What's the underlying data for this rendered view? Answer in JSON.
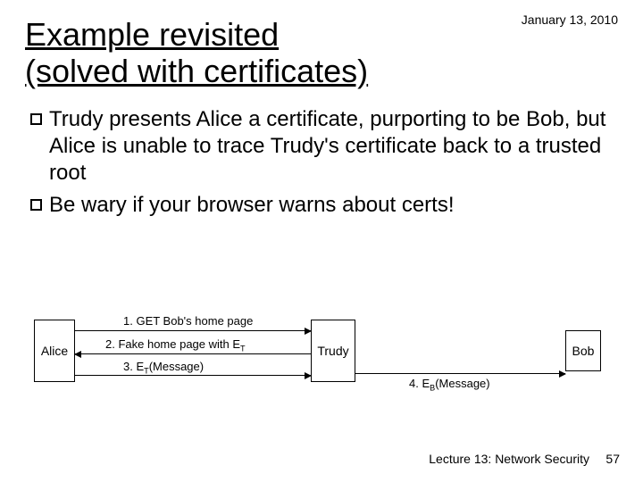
{
  "header": {
    "date": "January 13, 2010",
    "title_line1": "Example revisited",
    "title_line2": "(solved with certificates)"
  },
  "bullets": [
    "Trudy presents Alice a certificate, purporting to be Bob, but Alice is unable to trace Trudy's certificate back to a trusted root",
    "Be wary if your browser warns about certs!"
  ],
  "diagram": {
    "nodes": {
      "alice": "Alice",
      "trudy": "Trudy",
      "bob": "Bob"
    },
    "edges": {
      "e1": "1. GET Bob's home page",
      "e2_prefix": "2. Fake home page with E",
      "e2_sub": "T",
      "e3_prefix": "3. E",
      "e3_sub": "T",
      "e3_suffix": "(Message)",
      "e4_prefix": "4. E",
      "e4_sub": "B",
      "e4_suffix": "(Message)"
    }
  },
  "footer": {
    "lecture": "Lecture 13: Network Security",
    "page": "57"
  }
}
